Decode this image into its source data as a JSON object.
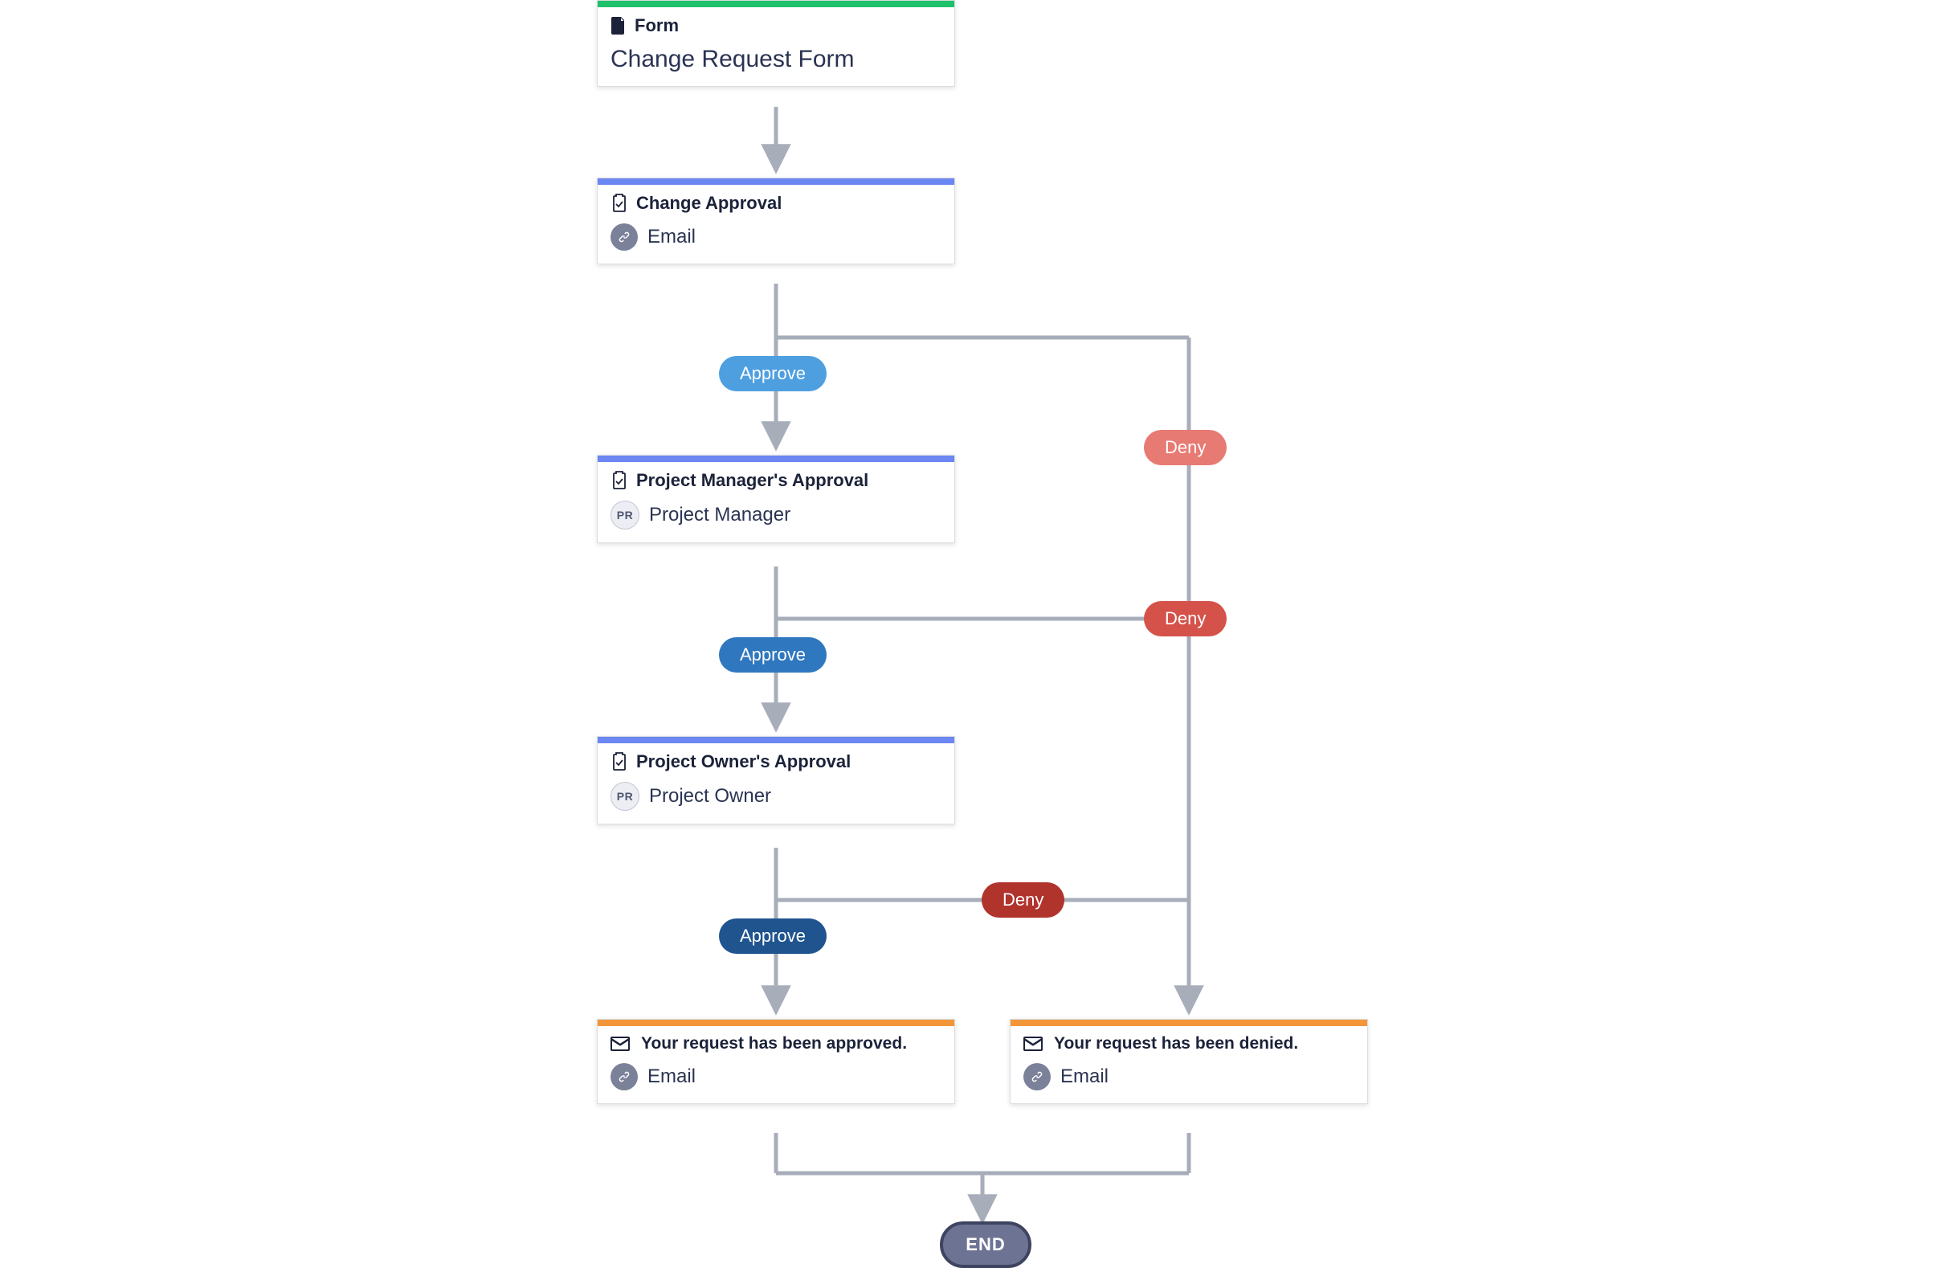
{
  "colors": {
    "stripe_green": "#1fc16b",
    "stripe_blue": "#6c87f2",
    "stripe_orange": "#f3963a",
    "approve1": "#4e9fe0",
    "approve2": "#2f77bf",
    "approve3": "#1f548f",
    "deny1": "#e77a72",
    "deny2": "#d4524a",
    "deny3": "#b0332c",
    "connector": "#a8adba",
    "end_fill": "#6d7392",
    "end_border": "#3e4460"
  },
  "nodes": {
    "form": {
      "header_label": "Form",
      "title": "Change Request Form"
    },
    "change_approval": {
      "header_label": "Change Approval",
      "assignee_type": "Email"
    },
    "pm_approval": {
      "header_label": "Project Manager's Approval",
      "assignee_initials": "PR",
      "assignee_name": "Project Manager"
    },
    "po_approval": {
      "header_label": "Project Owner's Approval",
      "assignee_initials": "PR",
      "assignee_name": "Project Owner"
    },
    "approved_email": {
      "header_label": "Your request has been approved.",
      "assignee_type": "Email"
    },
    "denied_email": {
      "header_label": "Your request has been denied.",
      "assignee_type": "Email"
    }
  },
  "pills": {
    "approve1": "Approve",
    "approve2": "Approve",
    "approve3": "Approve",
    "deny1": "Deny",
    "deny2": "Deny",
    "deny3": "Deny"
  },
  "end_label": "END"
}
